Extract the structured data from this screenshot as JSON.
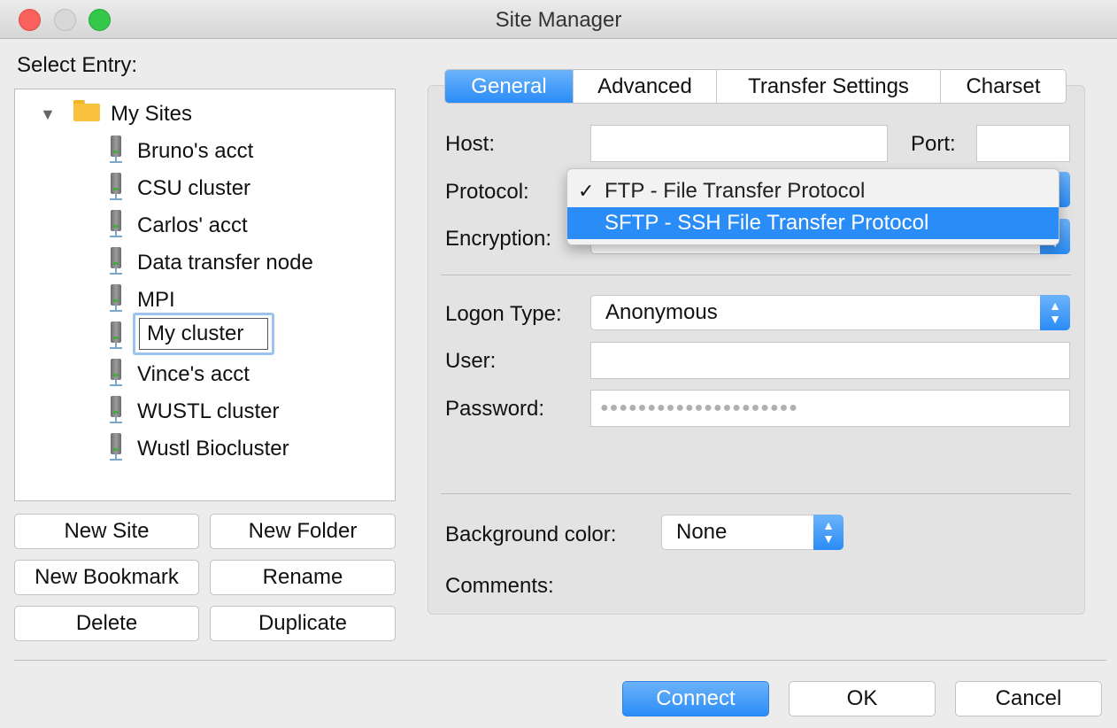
{
  "window": {
    "title": "Site Manager"
  },
  "left": {
    "select_entry_label": "Select Entry:",
    "root_folder": "My Sites",
    "sites": [
      "Bruno's acct",
      "CSU cluster",
      "Carlos' acct",
      "Data transfer node",
      "MPI",
      "My cluster",
      "Vince's acct",
      "WUSTL cluster",
      "Wustl Biocluster"
    ],
    "renaming_value": "My cluster",
    "buttons": {
      "new_site": "New Site",
      "new_folder": "New Folder",
      "new_bookmark": "New Bookmark",
      "rename": "Rename",
      "delete": "Delete",
      "duplicate": "Duplicate"
    }
  },
  "tabs": [
    "General",
    "Advanced",
    "Transfer Settings",
    "Charset"
  ],
  "active_tab": "General",
  "general": {
    "host_label": "Host:",
    "host_value": "",
    "port_label": "Port:",
    "port_value": "",
    "protocol_label": "Protocol:",
    "protocol_options": [
      "FTP - File Transfer Protocol",
      "SFTP - SSH File Transfer Protocol"
    ],
    "protocol_checked": "FTP - File Transfer Protocol",
    "protocol_highlighted": "SFTP - SSH File Transfer Protocol",
    "encryption_label": "Encryption:",
    "logon_type_label": "Logon Type:",
    "logon_type_value": "Anonymous",
    "user_label": "User:",
    "user_value": "",
    "password_label": "Password:",
    "password_value": "●●●●●●●●●●●●●●●●●●●●●",
    "background_color_label": "Background color:",
    "background_color_value": "None",
    "comments_label": "Comments:"
  },
  "footer": {
    "connect": "Connect",
    "ok": "OK",
    "cancel": "Cancel"
  },
  "colors": {
    "accent": "#2a8cf7",
    "folder": "#f9c23c"
  }
}
